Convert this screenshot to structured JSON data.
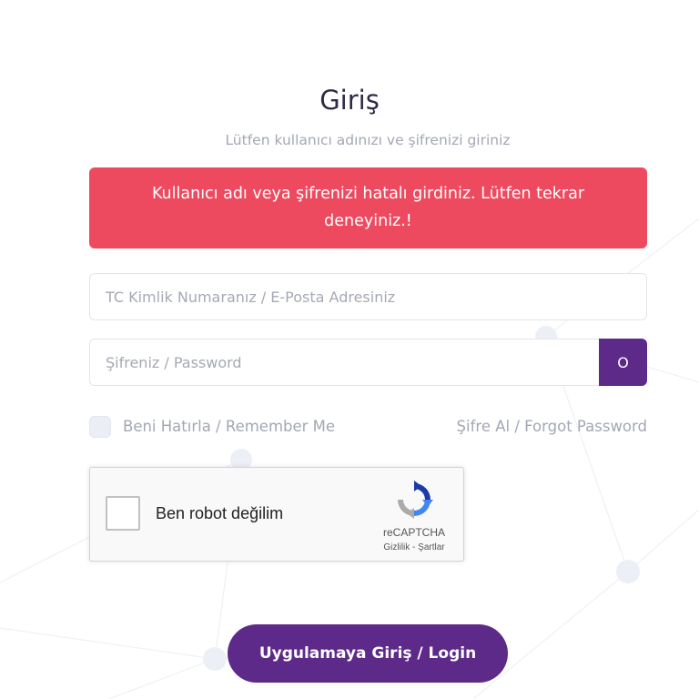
{
  "page": {
    "title": "Giriş",
    "subtitle": "Lütfen kullanıcı adınızı ve şifrenizi giriniz"
  },
  "alert": {
    "message": "Kullanıcı adı veya şifrenizi hatalı girdiniz. Lütfen tekrar deneyiniz.!"
  },
  "form": {
    "username": {
      "value": "",
      "placeholder": "TC Kimlik Numaranız / E-Posta Adresiniz"
    },
    "password": {
      "value": "",
      "placeholder": "Şifreniz / Password"
    },
    "password_toggle_label": "O",
    "remember_me": {
      "label": "Beni Hatırla / Remember Me",
      "checked": false
    },
    "forgot_password_label": "Şifre Al / Forgot Password",
    "submit_label": "Uygulamaya Giriş / Login"
  },
  "recaptcha": {
    "label": "Ben robot değilim",
    "brand": "reCAPTCHA",
    "terms": "Gizlilik - Şartlar",
    "icon": "recaptcha-logo-icon"
  },
  "colors": {
    "primary": "#5d2a89",
    "alert": "#ee4a5f",
    "text_muted": "#a3a7b5",
    "title": "#2f2b45"
  }
}
